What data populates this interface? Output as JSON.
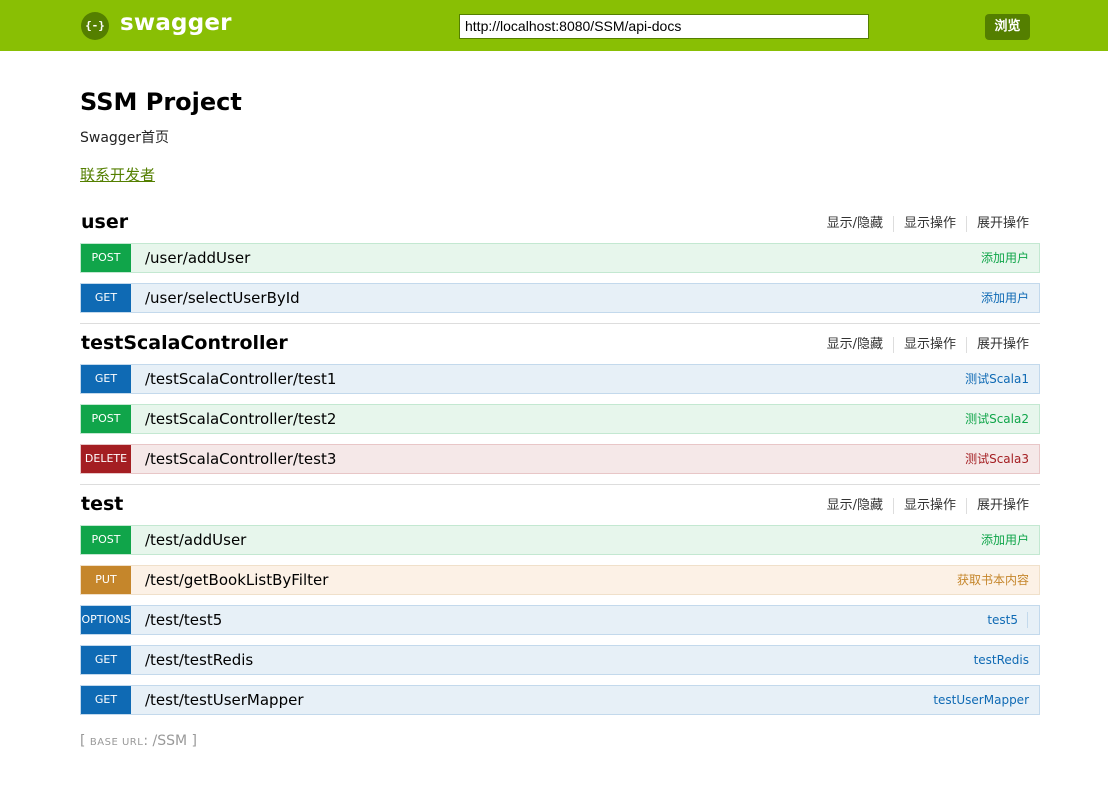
{
  "header": {
    "logo_text": "{-}",
    "brand": "swagger",
    "url_value": "http://localhost:8080/SSM/api-docs",
    "explore_label": "浏览",
    "brand_color": "#89bf04"
  },
  "info": {
    "title": "SSM Project",
    "description": "Swagger首页",
    "contact_label": "联系开发者"
  },
  "group_actions": {
    "toggle": "显示/隐藏",
    "list": "显示操作",
    "expand": "展开操作"
  },
  "groups": [
    {
      "name": "user",
      "operations": [
        {
          "method": "POST",
          "path": "/user/addUser",
          "summary": "添加用户"
        },
        {
          "method": "GET",
          "path": "/user/selectUserById",
          "summary": "添加用户"
        }
      ]
    },
    {
      "name": "testScalaController",
      "operations": [
        {
          "method": "GET",
          "path": "/testScalaController/test1",
          "summary": "测试Scala1"
        },
        {
          "method": "POST",
          "path": "/testScalaController/test2",
          "summary": "测试Scala2"
        },
        {
          "method": "DELETE",
          "path": "/testScalaController/test3",
          "summary": "测试Scala3"
        }
      ]
    },
    {
      "name": "test",
      "operations": [
        {
          "method": "POST",
          "path": "/test/addUser",
          "summary": "添加用户"
        },
        {
          "method": "PUT",
          "path": "/test/getBookListByFilter",
          "summary": "获取书本内容"
        },
        {
          "method": "OPTIONS",
          "path": "/test/test5",
          "summary": "test5"
        },
        {
          "method": "GET",
          "path": "/test/testRedis",
          "summary": "testRedis"
        },
        {
          "method": "GET",
          "path": "/test/testUserMapper",
          "summary": "testUserMapper"
        }
      ]
    }
  ],
  "footer": {
    "base_url_label": "base url",
    "base_url_value": "/SSM"
  }
}
